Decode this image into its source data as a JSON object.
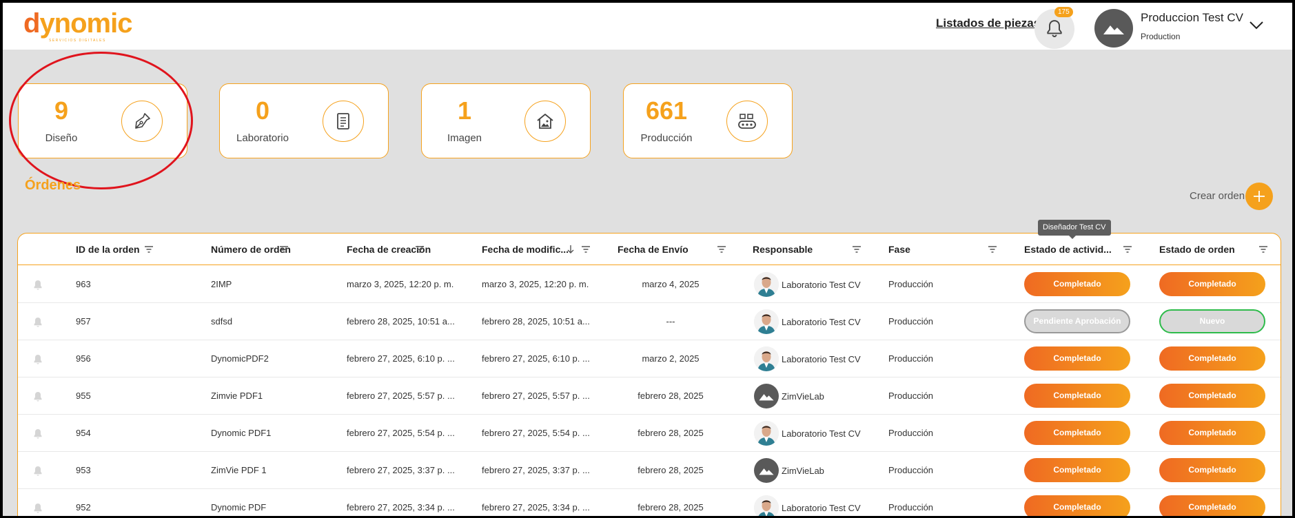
{
  "header": {
    "logo_main": "dynomic",
    "logo_sub": "SERVICIOS DIGITALES",
    "pieces_link": "Listados de piezas",
    "notification_count": "175",
    "user_name": "Produccion Test CV",
    "user_role": "Production"
  },
  "stats": [
    {
      "value": "9",
      "label": "Diseño",
      "icon": "pen-nib-icon"
    },
    {
      "value": "0",
      "label": "Laboratorio",
      "icon": "document-icon"
    },
    {
      "value": "1",
      "label": "Imagen",
      "icon": "house-image-icon"
    },
    {
      "value": "661",
      "label": "Producción",
      "icon": "conveyor-icon"
    }
  ],
  "orders": {
    "title": "Órdenes",
    "create_label": "Crear orden",
    "tooltip": "Diseñador Test CV"
  },
  "columns": [
    "ID de la orden",
    "Número de orden",
    "Fecha de creación",
    "Fecha de modific...",
    "Fecha de Envío",
    "Responsable",
    "Fase",
    "Estado de activid...",
    "Estado de orden"
  ],
  "rows": [
    {
      "id": "963",
      "numero": "2IMP",
      "creacion": "marzo 3, 2025, 12:20 p. m.",
      "modificacion": "marzo 3, 2025, 12:20 p. m.",
      "envio": "marzo 4, 2025",
      "responsable": "Laboratorio Test CV",
      "avatar": "photo",
      "fase": "Producción",
      "actividad": "Completado",
      "actividad_style": "done",
      "estado": "Completado",
      "estado_style": "done"
    },
    {
      "id": "957",
      "numero": "sdfsd",
      "creacion": "febrero 28, 2025, 10:51 a...",
      "modificacion": "febrero 28, 2025, 10:51 a...",
      "envio": "---",
      "responsable": "Laboratorio Test CV",
      "avatar": "photo",
      "fase": "Producción",
      "actividad": "Pendiente Aprobación",
      "actividad_style": "pending",
      "estado": "Nuevo",
      "estado_style": "new"
    },
    {
      "id": "956",
      "numero": "DynomicPDF2",
      "creacion": "febrero 27, 2025, 6:10 p. ...",
      "modificacion": "febrero 27, 2025, 6:10 p. ...",
      "envio": "marzo 2, 2025",
      "responsable": "Laboratorio Test CV",
      "avatar": "photo",
      "fase": "Producción",
      "actividad": "Completado",
      "actividad_style": "done",
      "estado": "Completado",
      "estado_style": "done"
    },
    {
      "id": "955",
      "numero": "Zimvie PDF1",
      "creacion": "febrero 27, 2025, 5:57 p. ...",
      "modificacion": "febrero 27, 2025, 5:57 p. ...",
      "envio": "febrero 28, 2025",
      "responsable": "ZimVieLab",
      "avatar": "placeholder",
      "fase": "Producción",
      "actividad": "Completado",
      "actividad_style": "done",
      "estado": "Completado",
      "estado_style": "done"
    },
    {
      "id": "954",
      "numero": "Dynomic PDF1",
      "creacion": "febrero 27, 2025, 5:54 p. ...",
      "modificacion": "febrero 27, 2025, 5:54 p. ...",
      "envio": "febrero 28, 2025",
      "responsable": "Laboratorio Test CV",
      "avatar": "photo",
      "fase": "Producción",
      "actividad": "Completado",
      "actividad_style": "done",
      "estado": "Completado",
      "estado_style": "done"
    },
    {
      "id": "953",
      "numero": "ZimVie PDF 1",
      "creacion": "febrero 27, 2025, 3:37 p. ...",
      "modificacion": "febrero 27, 2025, 3:37 p. ...",
      "envio": "febrero 28, 2025",
      "responsable": "ZimVieLab",
      "avatar": "placeholder",
      "fase": "Producción",
      "actividad": "Completado",
      "actividad_style": "done",
      "estado": "Completado",
      "estado_style": "done"
    },
    {
      "id": "952",
      "numero": "Dynomic PDF",
      "creacion": "febrero 27, 2025, 3:34 p. ...",
      "modificacion": "febrero 27, 2025, 3:34 p. ...",
      "envio": "febrero 28, 2025",
      "responsable": "Laboratorio Test CV",
      "avatar": "photo",
      "fase": "Producción",
      "actividad": "Completado",
      "actividad_style": "done",
      "estado": "Completado",
      "estado_style": "done"
    }
  ],
  "colors": {
    "accent": "#f5a11c",
    "accent_dark": "#ef6a22",
    "highlight": "#e0141d",
    "success": "#2dbb4a"
  }
}
